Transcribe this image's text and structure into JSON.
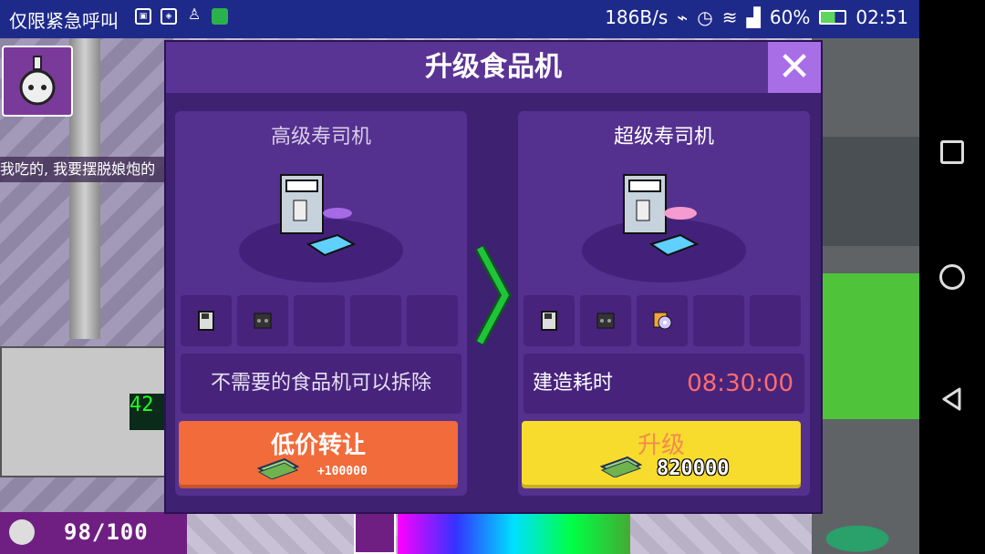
{
  "status_bar": {
    "carrier": "仅限紧急呼叫",
    "net_speed": "186B/s",
    "battery": "60%",
    "time": "02:51",
    "icons": [
      "gallery-icon",
      "game-box-icon",
      "clean-icon",
      "wechat-icon",
      "vibrate-icon",
      "alarm-icon",
      "wifi-icon",
      "signal-icon",
      "battery-icon"
    ]
  },
  "game": {
    "chat_text": "我吃的, 我要摆脱娘炮的",
    "population": "98/100",
    "machine_display": "42"
  },
  "dialog": {
    "title": "升级食品机",
    "close_glyph": "✕",
    "current": {
      "name": "高级寿司机",
      "info": "不需要的食品机可以拆除",
      "button_label": "低价转让",
      "price": "+100000",
      "slots": [
        "floppy-disk-icon",
        "cassette-icon",
        "",
        "",
        ""
      ]
    },
    "next": {
      "name": "超级寿司机",
      "build_time_label": "建造耗时",
      "build_time": "08:30:00",
      "button_label": "升级",
      "price": "820000",
      "slots": [
        "floppy-disk-icon",
        "cassette-icon",
        "cd-icon",
        "",
        ""
      ]
    }
  },
  "colors": {
    "dialog_bg": "#3e2171",
    "title_bar": "#5a3495",
    "close_button": "#a86ee6",
    "sell_button": "#f26b3a",
    "upgrade_button": "#f7dc2e",
    "arrow": "#1fc43a",
    "time_text": "#ff6c6c"
  }
}
